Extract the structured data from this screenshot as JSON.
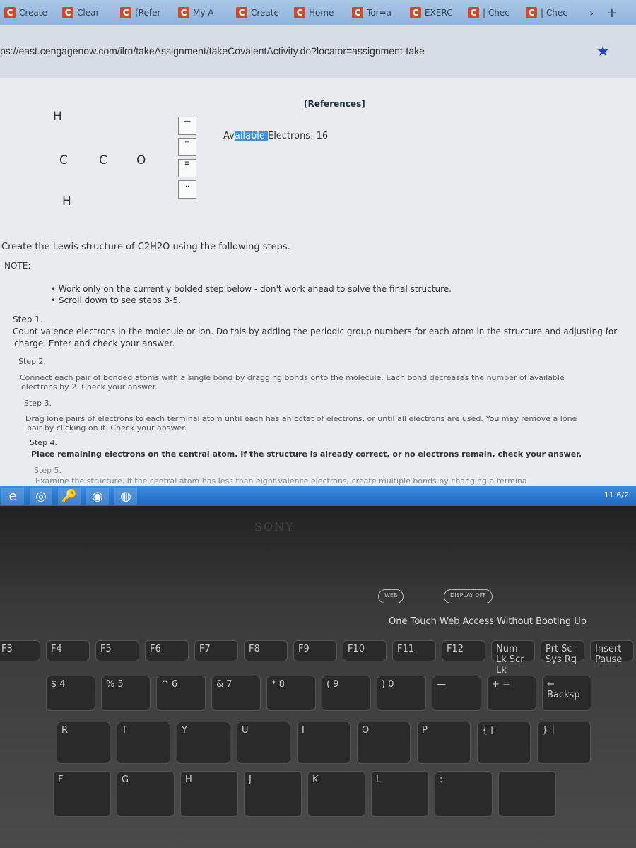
{
  "browser": {
    "tabs": [
      "Create",
      "Clear",
      "(Refer",
      "My A",
      "Create",
      "Home",
      "Tor=a",
      "EXERC",
      "| Chec",
      "| Chec"
    ],
    "url": "ps://east.cengagenow.com/ilrn/takeAssignment/takeCovalentActivity.do?locator=assignment-take"
  },
  "activity": {
    "references": "[References]",
    "available_prefix": "Av",
    "available_hl": "ailable ",
    "available_rest": "Electrons: 16",
    "atoms": [
      "H",
      "C",
      "C",
      "O",
      "H"
    ],
    "tools": [
      "—",
      "=",
      "≡",
      ".."
    ]
  },
  "instructions": {
    "intro": "Create the Lewis structure of C2H2O using the following steps.",
    "note": "NOTE:",
    "bullets": [
      "• Work only on the currently bolded step below - don't work ahead to solve the final structure.",
      "• Scroll down to see steps 3-5."
    ],
    "steps": [
      {
        "title": "Step 1.",
        "text": "Count valence electrons in the molecule or ion. Do this by adding the periodic group numbers for each atom in the structure and adjusting for",
        "text2": "charge. Enter and check your answer."
      },
      {
        "title": "Step 2.",
        "text": "Connect each pair of bonded atoms with a single bond by dragging bonds onto the molecule. Each bond decreases the number of available",
        "text2": "electrons by 2. Check your answer."
      },
      {
        "title": "Step 3.",
        "text": "Drag lone pairs of electrons to each terminal atom until each has an octet of electrons, or until all electrons are used. You may remove a lone",
        "text2": "pair by clicking on it. Check your answer."
      },
      {
        "title": "Step 4.",
        "text": "Place remaining electrons on the central atom. If the structure is already correct, or no electrons remain, check your answer."
      },
      {
        "title": "Step 5.",
        "text": "Examine the structure. If the central atom has less than eight valence electrons, create multiple bonds by changing a termina"
      }
    ]
  },
  "taskbar": {
    "apps": [
      "e",
      "◎",
      "🔑",
      "◉",
      "◍"
    ],
    "clock": "11 6/2"
  },
  "keyboard": {
    "brand": "SONY",
    "web": "WEB",
    "display_off": "DISPLAY OFF",
    "tagline": "One Touch Web Access Without Booting Up",
    "fkeys": [
      "F3",
      "F4",
      "F5",
      "F6",
      "F7",
      "F8",
      "F9",
      "F10",
      "F11",
      "F12",
      "Num Lk Scr Lk",
      "Prt Sc Sys Rq",
      "Insert Pause"
    ],
    "numrow": [
      "$ 4",
      "% 5",
      "^ 6",
      "& 7",
      "* 8",
      "( 9",
      ") 0",
      "—",
      "+ =",
      "← Backsp"
    ],
    "row2": [
      "R",
      "T",
      "Y",
      "U",
      "I",
      "O",
      "P",
      "{ [",
      "} ]"
    ],
    "row3": [
      "F",
      "G",
      "H",
      "J",
      "K",
      "L",
      ":",
      ""
    ]
  }
}
